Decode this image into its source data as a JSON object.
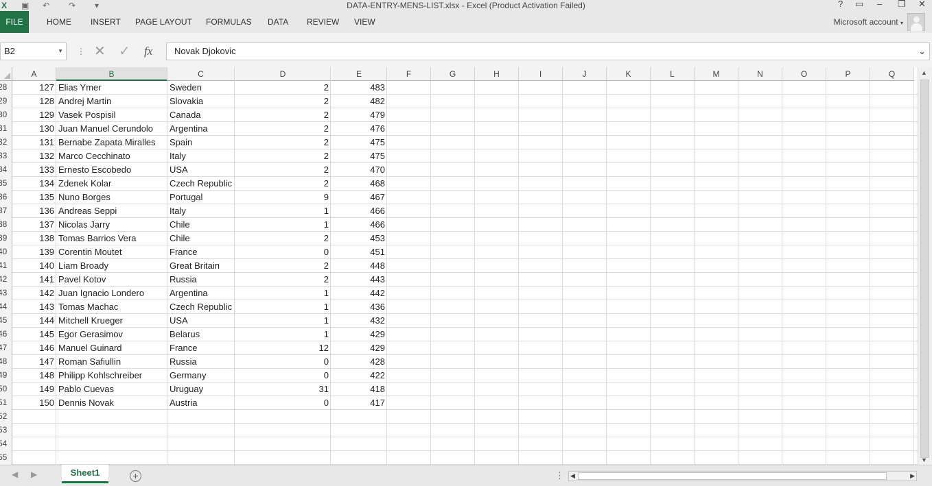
{
  "window": {
    "title": "DATA-ENTRY-MENS-LIST.xlsx - Excel (Product Activation Failed)",
    "help_label": "?",
    "close_glyph": "✕"
  },
  "ribbon": {
    "file_label": "FILE",
    "tabs": [
      "HOME",
      "INSERT",
      "PAGE LAYOUT",
      "FORMULAS",
      "DATA",
      "REVIEW",
      "VIEW"
    ],
    "account_label": "Microsoft account"
  },
  "formula_bar": {
    "name_box": "B2",
    "fx_label": "fx",
    "content": "Novak Djokovic"
  },
  "sheet": {
    "columns": [
      "A",
      "B",
      "C",
      "D",
      "E",
      "F",
      "G",
      "H",
      "I",
      "J",
      "K",
      "L",
      "M",
      "N",
      "O",
      "P",
      "Q"
    ],
    "selected_column": "B",
    "rows": [
      {
        "n": "28",
        "a": "127",
        "b": "Elias Ymer",
        "c": "Sweden",
        "d": "2",
        "e": "483"
      },
      {
        "n": "29",
        "a": "128",
        "b": "Andrej Martin",
        "c": "Slovakia",
        "d": "2",
        "e": "482"
      },
      {
        "n": "30",
        "a": "129",
        "b": "Vasek Pospisil",
        "c": "Canada",
        "d": "2",
        "e": "479"
      },
      {
        "n": "31",
        "a": "130",
        "b": "Juan Manuel Cerundolo",
        "c": "Argentina",
        "d": "2",
        "e": "476"
      },
      {
        "n": "32",
        "a": "131",
        "b": "Bernabe Zapata Miralles",
        "c": "Spain",
        "d": "2",
        "e": "475"
      },
      {
        "n": "33",
        "a": "132",
        "b": "Marco Cecchinato",
        "c": "Italy",
        "d": "2",
        "e": "475"
      },
      {
        "n": "34",
        "a": "133",
        "b": "Ernesto Escobedo",
        "c": "USA",
        "d": "2",
        "e": "470"
      },
      {
        "n": "35",
        "a": "134",
        "b": "Zdenek Kolar",
        "c": "Czech Republic",
        "d": "2",
        "e": "468"
      },
      {
        "n": "36",
        "a": "135",
        "b": "Nuno Borges",
        "c": "Portugal",
        "d": "9",
        "e": "467"
      },
      {
        "n": "37",
        "a": "136",
        "b": "Andreas Seppi",
        "c": "Italy",
        "d": "1",
        "e": "466"
      },
      {
        "n": "38",
        "a": "137",
        "b": "Nicolas Jarry",
        "c": "Chile",
        "d": "1",
        "e": "466"
      },
      {
        "n": "39",
        "a": "138",
        "b": "Tomas Barrios Vera",
        "c": "Chile",
        "d": "2",
        "e": "453"
      },
      {
        "n": "40",
        "a": "139",
        "b": "Corentin Moutet",
        "c": "France",
        "d": "0",
        "e": "451"
      },
      {
        "n": "41",
        "a": "140",
        "b": "Liam Broady",
        "c": "Great Britain",
        "d": "2",
        "e": "448"
      },
      {
        "n": "42",
        "a": "141",
        "b": "Pavel Kotov",
        "c": "Russia",
        "d": "2",
        "e": "443"
      },
      {
        "n": "43",
        "a": "142",
        "b": "Juan Ignacio Londero",
        "c": "Argentina",
        "d": "1",
        "e": "442"
      },
      {
        "n": "44",
        "a": "143",
        "b": "Tomas Machac",
        "c": "Czech Republic",
        "d": "1",
        "e": "436"
      },
      {
        "n": "45",
        "a": "144",
        "b": "Mitchell Krueger",
        "c": "USA",
        "d": "1",
        "e": "432"
      },
      {
        "n": "46",
        "a": "145",
        "b": "Egor Gerasimov",
        "c": "Belarus",
        "d": "1",
        "e": "429"
      },
      {
        "n": "47",
        "a": "146",
        "b": "Manuel Guinard",
        "c": "France",
        "d": "12",
        "e": "429"
      },
      {
        "n": "48",
        "a": "147",
        "b": "Roman Safiullin",
        "c": "Russia",
        "d": "0",
        "e": "428"
      },
      {
        "n": "49",
        "a": "148",
        "b": "Philipp Kohlschreiber",
        "c": "Germany",
        "d": "0",
        "e": "422"
      },
      {
        "n": "50",
        "a": "149",
        "b": "Pablo Cuevas",
        "c": "Uruguay",
        "d": "31",
        "e": "418"
      },
      {
        "n": "51",
        "a": "150",
        "b": "Dennis Novak",
        "c": "Austria",
        "d": "0",
        "e": "417"
      },
      {
        "n": "52",
        "a": "",
        "b": "",
        "c": "",
        "d": "",
        "e": ""
      },
      {
        "n": "53",
        "a": "",
        "b": "",
        "c": "",
        "d": "",
        "e": ""
      },
      {
        "n": "54",
        "a": "",
        "b": "",
        "c": "",
        "d": "",
        "e": ""
      },
      {
        "n": "55",
        "a": "",
        "b": "",
        "c": "",
        "d": "",
        "e": ""
      }
    ]
  },
  "footer": {
    "sheet_tab": "Sheet1",
    "add_sheet_glyph": "+"
  },
  "colors": {
    "excel_green": "#217346"
  }
}
